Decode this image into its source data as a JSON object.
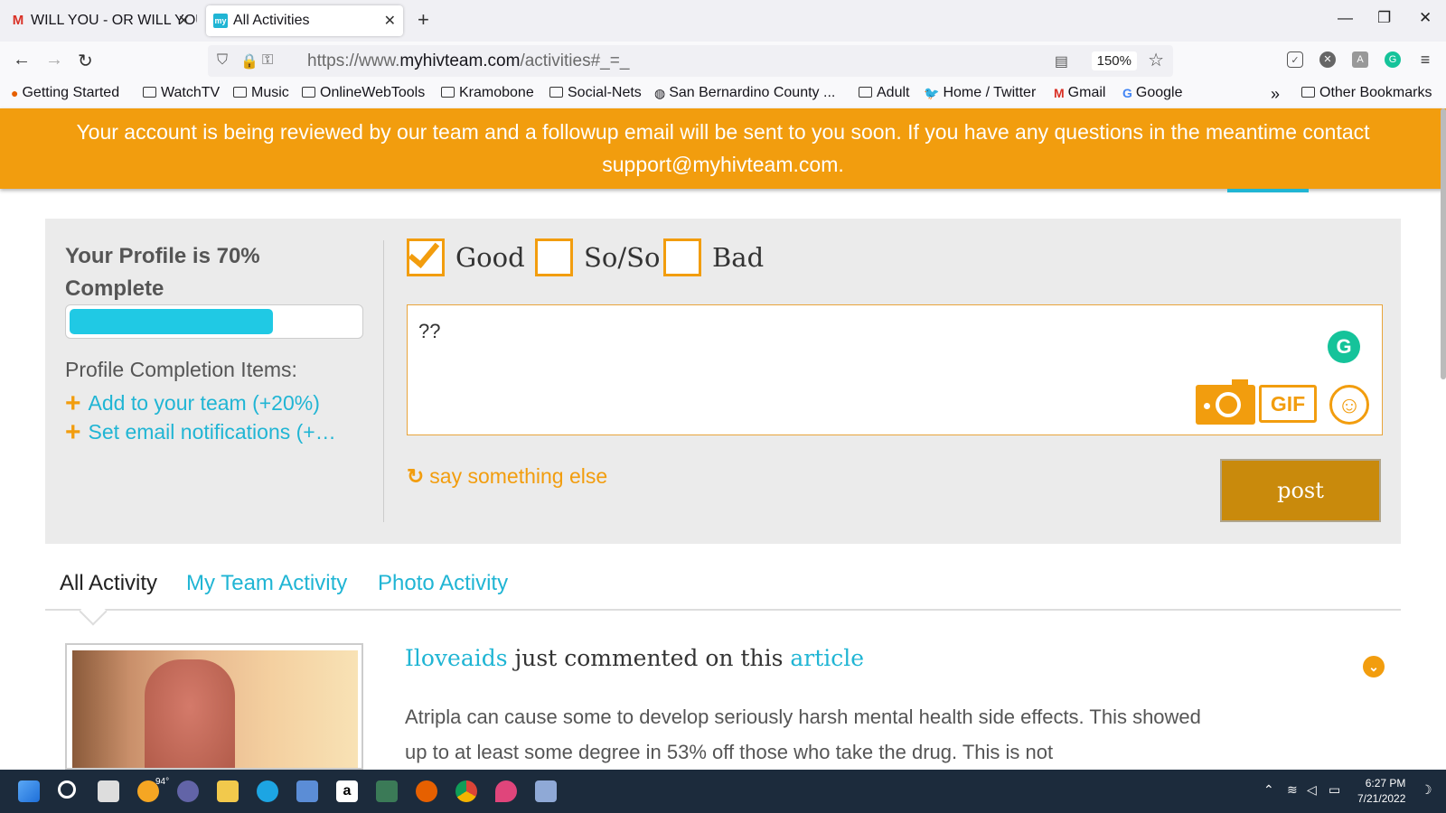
{
  "browser": {
    "tabs": [
      {
        "title": "WILL YOU - OR WILL YOU",
        "favicon": "gmail-icon"
      },
      {
        "title": "All Activities",
        "favicon": "myhivteam-icon",
        "favicon_text": "my"
      }
    ],
    "url": {
      "prefix": "https://www.",
      "domain": "myhivteam.com",
      "path": "/activities#_=_"
    },
    "zoom": "150%",
    "bookmarks": [
      {
        "label": "Getting Started",
        "icon": "firefox-icon"
      },
      {
        "label": "WatchTV",
        "icon": "folder-icon"
      },
      {
        "label": "Music",
        "icon": "folder-icon"
      },
      {
        "label": "OnlineWebTools",
        "icon": "folder-icon"
      },
      {
        "label": "Kramobone",
        "icon": "folder-icon"
      },
      {
        "label": "Social-Nets",
        "icon": "folder-icon"
      },
      {
        "label": "San Bernardino County ...",
        "icon": "globe-icon"
      },
      {
        "label": "Adult",
        "icon": "folder-icon"
      },
      {
        "label": "Home / Twitter",
        "icon": "twitter-icon"
      },
      {
        "label": "Gmail",
        "icon": "gmail-icon"
      },
      {
        "label": "Google",
        "icon": "google-icon"
      }
    ],
    "other_bookmarks": "Other Bookmarks"
  },
  "banner": {
    "message": "Your account is being reviewed by our team and a followup email will be sent to you soon. If you have any questions in the meantime contact support@myhivteam.com."
  },
  "profile": {
    "title": "Your Profile is 70% Complete",
    "progress_fraction": 0.7,
    "items_heading": "Profile Completion Items:",
    "items": [
      "Add to your team (+20%)",
      "Set email notifications (+…"
    ]
  },
  "composer": {
    "moods": [
      {
        "label": "Good",
        "checked": true
      },
      {
        "label": "So/So",
        "checked": false
      },
      {
        "label": "Bad",
        "checked": false
      }
    ],
    "text_value": "??",
    "gif_label": "GIF",
    "say_something_else": "say something else",
    "post_label": "post"
  },
  "activity_tabs": [
    "All Activity",
    "My Team Activity",
    "Photo Activity"
  ],
  "feed": {
    "user": "Iloveaids",
    "action": " just commented on this ",
    "target": "article",
    "body": "Atripla can cause some to develop seriously harsh mental health side effects. This showed up to at least some degree in 53% off those who take the drug. This is not"
  },
  "taskbar": {
    "temperature": "94°",
    "time": "6:27 PM",
    "date": "7/21/2022"
  },
  "colors": {
    "accent_orange": "#f29d0e",
    "link_cyan": "#20b5d4",
    "post_button": "#c98a0c",
    "progress_fill": "#20c9e4"
  }
}
